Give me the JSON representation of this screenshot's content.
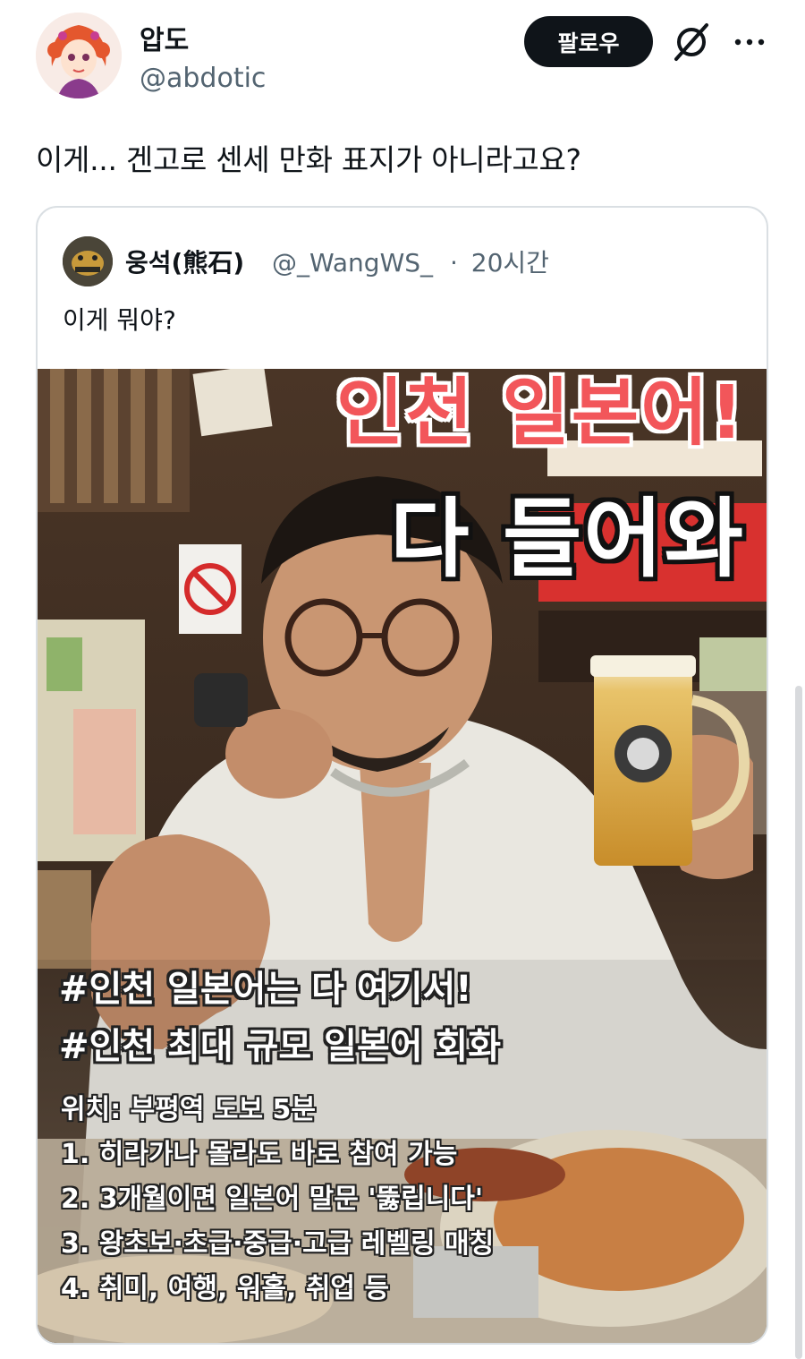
{
  "tweet": {
    "author": {
      "display_name": "압도",
      "handle": "@abdotic"
    },
    "follow_label": "팔로우",
    "text": "이게... 겐고로 센세 만화 표지가 아니라고요?"
  },
  "quote": {
    "author": {
      "display_name": "웅석(熊石)",
      "handle": "@_WangWS_",
      "separator": "·",
      "time": "20시간"
    },
    "text": "이게 뭐야?",
    "image": {
      "title_line1": "인천 일본어!",
      "title_line2": "다 들어와",
      "hashtag_1": "#인천 일본어는 다 여기서!",
      "hashtag_2": "#인천 최대 규모 일본어 회화",
      "location": "위치: 부평역 도보 5분",
      "points": [
        "1. 히라가나 몰라도 바로 참여 가능",
        "2. 3개월이면 일본어 말문 '뚫립니다'",
        "3. 왕초보·초급·중급·고급 레벨링 매칭",
        "4. 취미, 여행, 워홀, 취업 등"
      ]
    }
  },
  "icons": {
    "grok": "grok-icon",
    "more": "more-icon"
  },
  "colors": {
    "follow_bg": "#0f1419",
    "handle": "#536471",
    "title_red": "#f2565a"
  }
}
